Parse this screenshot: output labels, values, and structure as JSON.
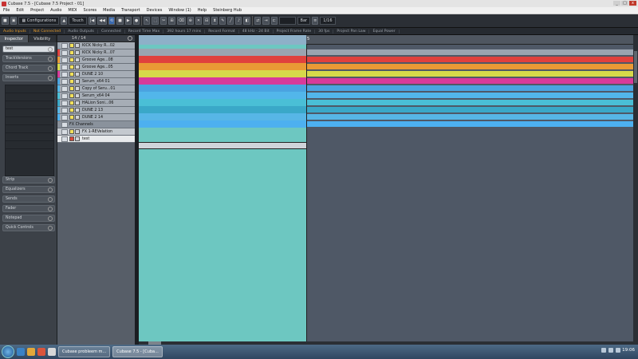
{
  "window": {
    "title": "Cubase 7.5 - [Cubase 7.5 Project - 01]",
    "controls": [
      "_",
      "□",
      "x"
    ]
  },
  "menu": [
    "File",
    "Edit",
    "Project",
    "Audio",
    "MIDI",
    "Scores",
    "Media",
    "Transport",
    "Devices",
    "Window (1)",
    "Help",
    "Steinberg Hub"
  ],
  "toolbar": {
    "configurations": "Configurations",
    "touch_mode": "Touch",
    "snap_value": "Bar",
    "quantize": "1/16"
  },
  "status": [
    "Audio Inputs",
    "Not Connected",
    "Audio Outputs",
    "Connected",
    "Record Time Max",
    "392 hours 17 mins",
    "Record Format",
    "48 kHz - 24 Bit",
    "Project Frame Rate",
    "30 fps",
    "Project Pan Law",
    "Equal Power"
  ],
  "inspector": {
    "tabs": [
      "Inspector",
      "Visibility"
    ],
    "track_name": "test",
    "sections_top": [
      "test",
      "TrackVersions",
      "Chord Track",
      "Inserts"
    ],
    "sections_bottom": [
      "Strip",
      "Equalizers",
      "Sends",
      "Fader",
      "Notepad",
      "Quick Controls"
    ]
  },
  "tracklist": {
    "count": "14 / 14",
    "tracks": [
      {
        "name": "KICK Nicky R...02",
        "color": "#9aa4b0",
        "type": "instrument"
      },
      {
        "name": "KICK Nicky R...07",
        "color": "#e0413d",
        "type": "instrument"
      },
      {
        "name": "Groove Age...08",
        "color": "#e99a35",
        "type": "instrument"
      },
      {
        "name": "Groove Age...05",
        "color": "#d6d94a",
        "type": "instrument"
      },
      {
        "name": "DUNE 2 10",
        "color": "#d83a9a",
        "type": "instrument"
      },
      {
        "name": "Serum_x64 01",
        "color": "#4aa3e0",
        "type": "instrument"
      },
      {
        "name": "Copy of Seru...01",
        "color": "#52b6ea",
        "type": "instrument"
      },
      {
        "name": "Serum_x64 04",
        "color": "#4abfd6",
        "type": "instrument"
      },
      {
        "name": "HALion Soni...06",
        "color": "#3aa8c8",
        "type": "instrument"
      },
      {
        "name": "DUNE 2 13",
        "color": "#57b6e6",
        "type": "instrument"
      },
      {
        "name": "DUNE 2 14",
        "color": "#4db0f0",
        "type": "instrument"
      },
      {
        "name": "FX Channels",
        "color": "#8a929c",
        "type": "folder"
      },
      {
        "name": "FX 1-REVelation",
        "color": "#c4c9cf",
        "type": "fx"
      },
      {
        "name": "test",
        "color": "#e8eaec",
        "type": "selected"
      }
    ]
  },
  "ruler": {
    "marker": "5"
  },
  "colors": {
    "cycle_area": "#6dc7c1",
    "arrange_bg": "#4f5866",
    "toolbar": "#2b2f35"
  },
  "taskbar": {
    "tasks": [
      "Cubase probleem m...",
      "Cubase 7.5 - [Cuba..."
    ],
    "time": "19:06"
  }
}
